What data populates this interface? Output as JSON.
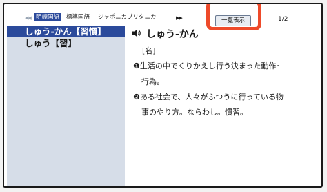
{
  "topbar": {
    "prev_arrow": "◀◀",
    "next_arrow": "▶▶",
    "tabs": [
      {
        "label": "明鏡国語"
      },
      {
        "label": "標準国語"
      },
      {
        "label": "ジャポニカ"
      },
      {
        "label": "ブリタニカ"
      }
    ],
    "list_button_label": "一覧表示",
    "page_indicator": "1/2"
  },
  "list": {
    "items": [
      {
        "label": "しゅう-かん【習慣】"
      },
      {
        "label": "しゅう【習】"
      }
    ]
  },
  "detail": {
    "headword": "しゅう-かん",
    "pos": "[名]",
    "definition_lines": [
      "❶生活の中でくりかえし行う決まった動作･",
      "行為。",
      "❷ある社会で、人々がふつうに行っている物",
      "事のやり方。ならわし。慣習。"
    ]
  },
  "colors": {
    "selected_blue": "#2b4a9b",
    "list_background": "#d6dde8",
    "highlight_red": "#ee4a2a"
  }
}
